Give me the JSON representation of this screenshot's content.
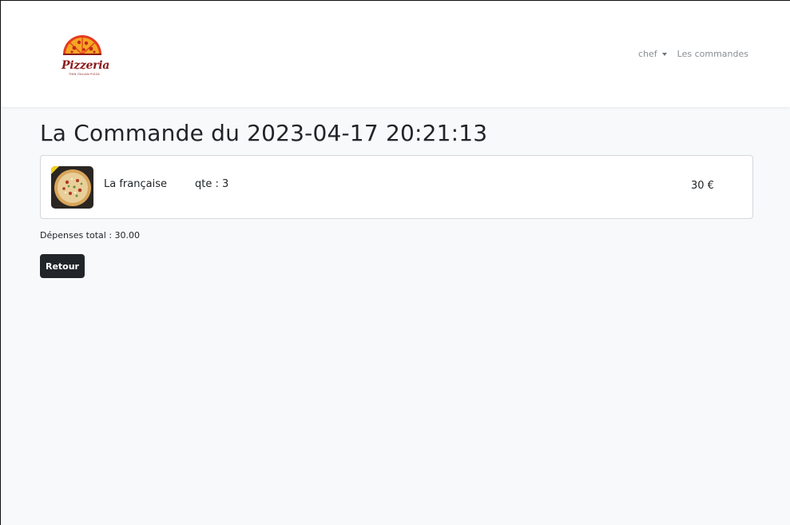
{
  "nav": {
    "logo_text": "Pizzeria",
    "logo_tagline": "THIN ITALIAN PIZZA",
    "user_menu_label": "chef",
    "orders_link_label": "Les commandes"
  },
  "page": {
    "title": "La Commande du 2023-04-17 20:21:13"
  },
  "order": {
    "items": [
      {
        "name": "La française",
        "quantity": "qte : 3",
        "price": "30 €",
        "image_icon": "pizza-image"
      }
    ],
    "total_label": "Dépenses total : 30.00"
  },
  "actions": {
    "back_label": "Retour"
  },
  "colors": {
    "navbar_bg": "#ffffff",
    "page_bg": "#f8f9fa",
    "button_bg": "#212529",
    "logo_red": "#8b1a1a",
    "logo_orange": "#f5a623"
  }
}
